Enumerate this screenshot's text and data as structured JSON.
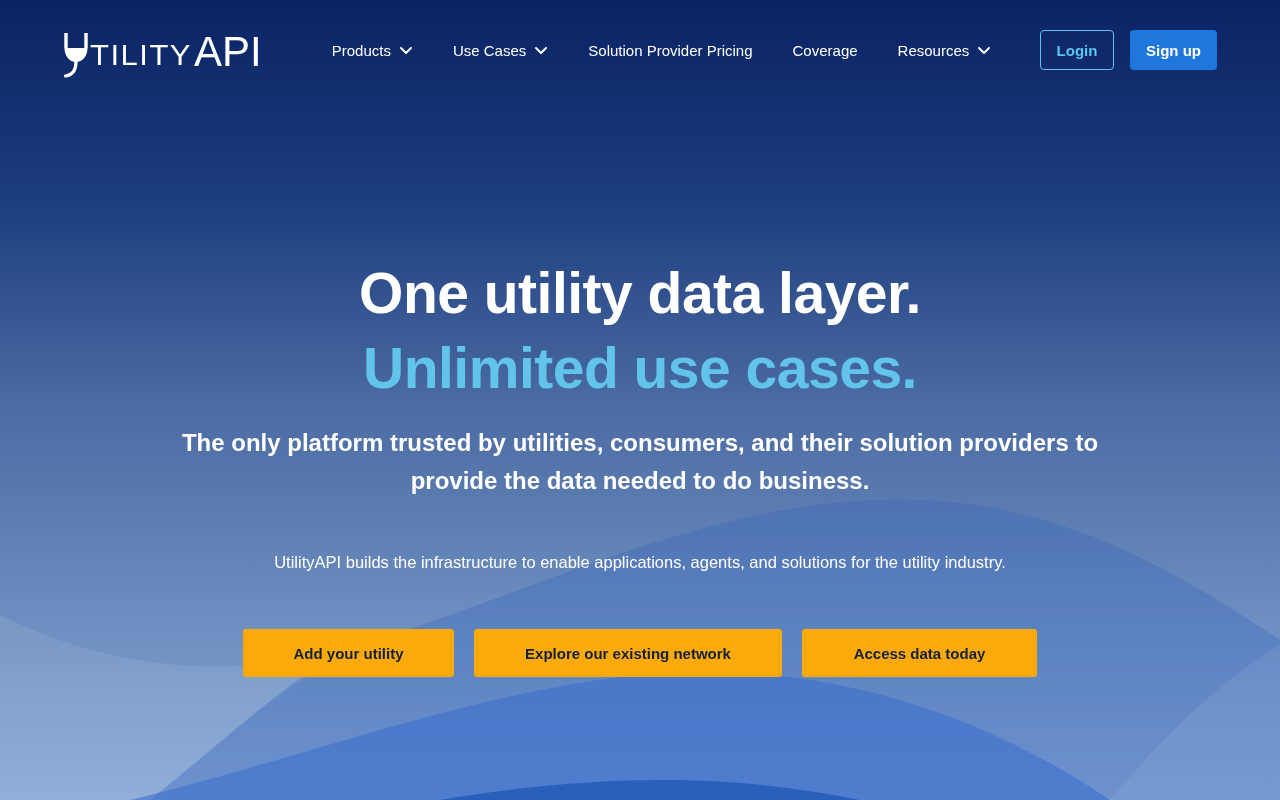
{
  "logo": {
    "letters": "TILITY",
    "suffix": "API"
  },
  "nav": {
    "items": [
      {
        "label": "Products",
        "has_menu": true
      },
      {
        "label": "Use Cases",
        "has_menu": true
      },
      {
        "label": "Solution Provider Pricing",
        "has_menu": false
      },
      {
        "label": "Coverage",
        "has_menu": false
      },
      {
        "label": "Resources",
        "has_menu": true
      }
    ],
    "login": "Login",
    "signup": "Sign up"
  },
  "hero": {
    "title": "One utility data layer.",
    "title_accent": "Unlimited use cases.",
    "subtitle": "The only platform trusted by utilities, consumers, and their solution providers to provide the data needed to do business.",
    "description": "UtilityAPI builds the infrastructure to enable applications, agents, and solutions for the utility industry.",
    "buttons": [
      "Add your utility",
      "Explore our existing network",
      "Access data today"
    ]
  }
}
